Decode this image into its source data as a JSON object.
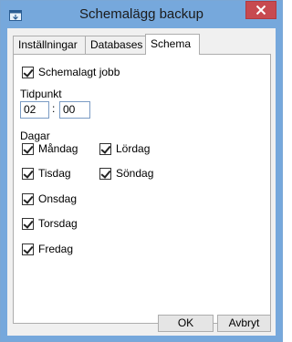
{
  "window": {
    "title": "Schemalägg backup",
    "app_icon": "app-icon",
    "close_icon": "close-icon"
  },
  "tabs": [
    {
      "label": "Inställningar",
      "active": false
    },
    {
      "label": "Databases",
      "active": false
    },
    {
      "label": "Schema",
      "active": true
    }
  ],
  "schedule": {
    "enabled_label": "Schemalagt jobb",
    "enabled": true,
    "time_label": "Tidpunkt",
    "hour": "02",
    "separator": ":",
    "minute": "00",
    "days_label": "Dagar",
    "days": [
      {
        "label": "Måndag",
        "checked": true
      },
      {
        "label": "Tisdag",
        "checked": true
      },
      {
        "label": "Onsdag",
        "checked": true
      },
      {
        "label": "Torsdag",
        "checked": true
      },
      {
        "label": "Fredag",
        "checked": true
      },
      {
        "label": "Lördag",
        "checked": true
      },
      {
        "label": "Söndag",
        "checked": true
      }
    ]
  },
  "buttons": {
    "ok": "OK",
    "cancel": "Avbryt"
  }
}
